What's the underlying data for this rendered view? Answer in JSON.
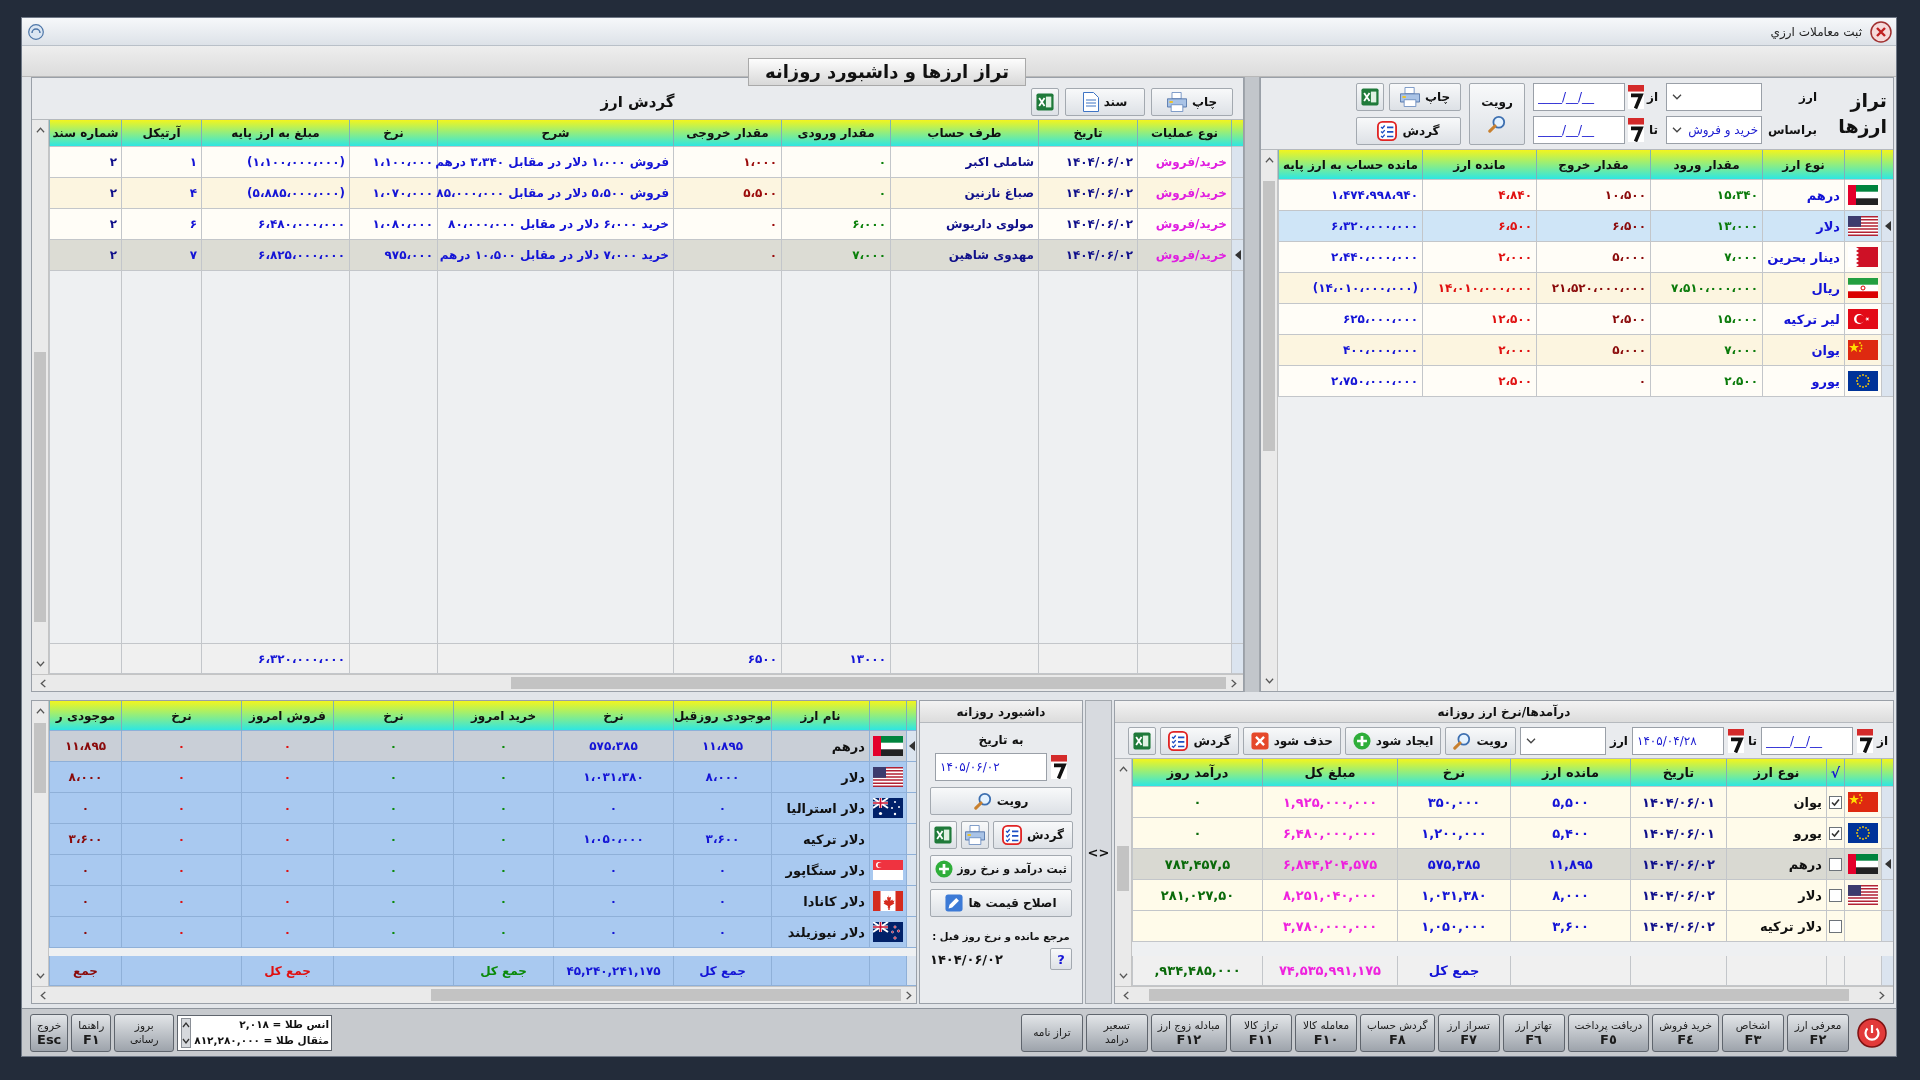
{
  "window": {
    "title": "ثبت معاملات ارزي"
  },
  "page_title": "تراز ارزها و داشبورد روزانه",
  "balance_panel": {
    "title": "تراز ارزها",
    "currency_label": "ارز",
    "basis_label": "براساس",
    "basis_value": "خرید و فروش",
    "from_label": "از",
    "from_date": {
      "placeholder": "____/__/__"
    },
    "to_label": "تا",
    "to_date": {
      "placeholder": "____/__/__"
    },
    "view_button": "رویت",
    "print_button": "چاپ",
    "turnover_button": "گردش",
    "columns": {
      "name": "نوع ارز",
      "incoming": "مقدار ورود",
      "outgoing": "مقدار خروج",
      "balance": "مانده ارز",
      "base_balance": "مانده حساب به ارز پایه"
    },
    "rows": [
      {
        "kind": "uae",
        "selected": false,
        "name": "درهم",
        "incoming": "۱۵،۳۴۰",
        "outgoing": "۱۰،۵۰۰",
        "balance": "۴،۸۴۰",
        "base_balance": "۱،۴۷۴،۹۹۸،۹۴۰"
      },
      {
        "kind": "usa",
        "selected": true,
        "name": "دلار",
        "incoming": "۱۳،۰۰۰",
        "outgoing": "۶،۵۰۰",
        "balance": "۶،۵۰۰",
        "base_balance": "۶،۳۲۰،۰۰۰،۰۰۰"
      },
      {
        "kind": "bahrain",
        "selected": false,
        "name": "دینار بحرین",
        "incoming": "۷،۰۰۰",
        "outgoing": "۵،۰۰۰",
        "balance": "۲،۰۰۰",
        "base_balance": "۲،۴۴۰،۰۰۰،۰۰۰"
      },
      {
        "kind": "iran",
        "selected": false,
        "name": "ریال",
        "incoming": "۷،۵۱۰،۰۰۰،۰۰۰",
        "outgoing": "۲۱،۵۲۰،۰۰۰،۰۰۰",
        "balance": "۱۴،۰۱۰،۰۰۰،۰۰۰",
        "base_balance": "(۱۴،۰۱۰،۰۰۰،۰۰۰)"
      },
      {
        "kind": "turkey",
        "selected": false,
        "name": "لیر ترکیه",
        "incoming": "۱۵،۰۰۰",
        "outgoing": "۲،۵۰۰",
        "balance": "۱۲،۵۰۰",
        "base_balance": "۶۲۵،۰۰۰،۰۰۰"
      },
      {
        "kind": "china",
        "selected": false,
        "name": "یوان",
        "incoming": "۷،۰۰۰",
        "outgoing": "۵،۰۰۰",
        "balance": "۲،۰۰۰",
        "base_balance": "۴۰۰،۰۰۰،۰۰۰"
      },
      {
        "kind": "eu",
        "selected": false,
        "name": "یورو",
        "incoming": "۲،۵۰۰",
        "outgoing": "۰",
        "balance": "۲،۵۰۰",
        "base_balance": "۲،۷۵۰،۰۰۰،۰۰۰"
      }
    ]
  },
  "turnover_panel": {
    "title": "گردش ارز",
    "print_button": "چاپ",
    "document_button": "سند",
    "columns": {
      "operation": "نوع عملیات",
      "date": "تاریخ",
      "counterparty": "طرف حساب",
      "incoming": "مقدار ورودی",
      "outgoing": "مقدار خروجی",
      "description": "شرح",
      "rate": "نرخ",
      "base_amount": "مبلغ به ارز پایه",
      "article": "آرتیکل",
      "doc_number": "شماره سند"
    },
    "rows": [
      {
        "selected": false,
        "operation": "خرید/فروش",
        "date": "۱۴۰۴/۰۶/۰۲",
        "counterparty": "شاملی اکبر",
        "incoming": "۰",
        "outgoing": "۱،۰۰۰",
        "description": "فروش ۱،۰۰۰ دلار در مقابل ۳،۳۴۰ درهم",
        "rate": "۱،۱۰۰،۰۰۰",
        "base_amount": "(۱،۱۰۰،۰۰۰،۰۰۰)",
        "article": "۱",
        "doc_number": "۲"
      },
      {
        "selected": false,
        "operation": "خرید/فروش",
        "date": "۱۴۰۴/۰۶/۰۲",
        "counterparty": "صباغ نازنین",
        "incoming": "۰",
        "outgoing": "۵،۵۰۰",
        "description": "فروش ۵،۵۰۰ دلار در مقابل ۸۵،۰۰۰،۰۰۰",
        "rate": "۱،۰۷۰،۰۰۰",
        "base_amount": "(۵،۸۸۵،۰۰۰،۰۰۰)",
        "article": "۴",
        "doc_number": "۲"
      },
      {
        "selected": false,
        "operation": "خرید/فروش",
        "date": "۱۴۰۴/۰۶/۰۲",
        "counterparty": "مولوی داریوش",
        "incoming": "۶،۰۰۰",
        "outgoing": "۰",
        "description": "خرید ۶،۰۰۰ دلار در مقابل ۸۰،۰۰۰،۰۰۰",
        "rate": "۱،۰۸۰،۰۰۰",
        "base_amount": "۶،۴۸۰،۰۰۰،۰۰۰",
        "article": "۶",
        "doc_number": "۲"
      },
      {
        "selected": true,
        "operation": "خرید/فروش",
        "date": "۱۴۰۴/۰۶/۰۲",
        "counterparty": "مهدوی شاهین",
        "incoming": "۷،۰۰۰",
        "outgoing": "۰",
        "description": "خرید ۷،۰۰۰ دلار در مقابل ۱۰،۵۰۰ درهم",
        "rate": "۹۷۵،۰۰۰",
        "base_amount": "۶،۸۲۵،۰۰۰،۰۰۰",
        "article": "۷",
        "doc_number": "۲"
      }
    ],
    "totals": {
      "incoming": "۱۳۰۰۰",
      "outgoing": "۶۵۰۰",
      "base_amount": "۶،۳۲۰،۰۰۰،۰۰۰"
    }
  },
  "inventory_panel": {
    "columns": {
      "name": "نام ارز",
      "prev_balance": "موجودی روزقبل",
      "prev_rate": "نرخ",
      "buy_today": "خرید امروز",
      "buy_rate": "نرخ",
      "sell_today": "فروش امروز",
      "sell_rate": "نرخ",
      "balance": "موجودی ر"
    },
    "rows": [
      {
        "kind": "uae",
        "selected": true,
        "name": "درهم",
        "prev_balance": "۱۱،۸۹۵",
        "prev_rate": "۵۷۵،۳۸۵",
        "buy_today": "۰",
        "buy_rate": "۰",
        "sell_today": "۰",
        "sell_rate": "۰",
        "balance": "۱۱،۸۹۵"
      },
      {
        "kind": "usa",
        "selected": false,
        "name": "دلار",
        "prev_balance": "۸،۰۰۰",
        "prev_rate": "۱،۰۳۱،۳۸۰",
        "buy_today": "۰",
        "buy_rate": "۰",
        "sell_today": "۰",
        "sell_rate": "۰",
        "balance": "۸،۰۰۰"
      },
      {
        "kind": "australia",
        "selected": false,
        "name": "دلار استرالیا",
        "prev_balance": "۰",
        "prev_rate": "۰",
        "buy_today": "۰",
        "buy_rate": "۰",
        "sell_today": "۰",
        "sell_rate": "۰",
        "balance": "۰"
      },
      {
        "selected": false,
        "name": "دلار ترکیه",
        "prev_balance": "۳،۶۰۰",
        "prev_rate": "۱،۰۵۰،۰۰۰",
        "buy_today": "۰",
        "buy_rate": "۰",
        "sell_today": "۰",
        "sell_rate": "۰",
        "balance": "۳،۶۰۰"
      },
      {
        "kind": "singapore",
        "selected": false,
        "name": "دلار سنگاپور",
        "prev_balance": "۰",
        "prev_rate": "۰",
        "buy_today": "۰",
        "buy_rate": "۰",
        "sell_today": "۰",
        "sell_rate": "۰",
        "balance": "۰"
      },
      {
        "kind": "canada",
        "selected": false,
        "name": "دلار کانادا",
        "prev_balance": "۰",
        "prev_rate": "۰",
        "buy_today": "۰",
        "buy_rate": "۰",
        "sell_today": "۰",
        "sell_rate": "۰",
        "balance": "۰"
      },
      {
        "kind": "new_zealand",
        "selected": false,
        "name": "دلار نیوزیلند",
        "prev_balance": "۰",
        "prev_rate": "۰",
        "buy_today": "۰",
        "buy_rate": "۰",
        "sell_today": "۰",
        "sell_rate": "۰",
        "balance": "۰"
      }
    ],
    "totals": {
      "prev_balance": "جمع کل",
      "prev_rate": "۴۵,۲۴۰,۲۴۱,۱۷۵",
      "buy_today": "جمع کل",
      "sell_today": "جمع کل",
      "balance": "جمع"
    }
  },
  "dashboard": {
    "title": "داشبورد روزانه",
    "date_label": "به تاریخ",
    "date": {
      "value": "۱۴۰۵/۰۶/۰۲"
    },
    "view_button": "رویت",
    "turnover_button": "گردش",
    "register_button": "ثبت درآمد و نرخ روز",
    "fix_prices_button": "اصلاح قیمت ها",
    "reference_label": "مرجع مانده و نرخ روز قبل :",
    "help_button": "?",
    "reference_date": "۱۴۰۴/۰۶/۰۲"
  },
  "splitter": "<>",
  "income_panel": {
    "title": "درآمدها/نرخ ارز روزانه",
    "from_label": "از",
    "from_date": {
      "placeholder": "____/__/__"
    },
    "to_label": "تا",
    "to_date": {
      "value": "۱۴۰۵/۰۴/۲۸"
    },
    "currency_label": "ارز",
    "view_button": "رویت",
    "create_button": "ایجاد شود",
    "delete_button": "حذف شود",
    "turnover_button": "گردش",
    "columns": {
      "check": "√",
      "name": "نوع ارز",
      "date": "تاریخ",
      "balance": "مانده ارز",
      "rate": "نرخ",
      "total": "مبلغ کل",
      "income": "درآمد روز"
    },
    "rows": [
      {
        "kind": "china",
        "checked": true,
        "selected": false,
        "name": "یوان",
        "date": "۱۴۰۴/۰۶/۰۱",
        "balance": "۵,۵۰۰",
        "rate": "۳۵۰,۰۰۰",
        "total": "۱,۹۲۵,۰۰۰,۰۰۰",
        "income": "۰"
      },
      {
        "kind": "eu",
        "checked": true,
        "selected": false,
        "name": "یورو",
        "date": "۱۴۰۴/۰۶/۰۱",
        "balance": "۵,۴۰۰",
        "rate": "۱,۲۰۰,۰۰۰",
        "total": "۶,۴۸۰,۰۰۰,۰۰۰",
        "income": "۰"
      },
      {
        "kind": "uae",
        "checked": false,
        "selected": true,
        "name": "درهم",
        "date": "۱۴۰۴/۰۶/۰۲",
        "balance": "۱۱,۸۹۵",
        "rate": "۵۷۵,۳۸۵",
        "total": "۶,۸۴۴,۲۰۴,۵۷۵",
        "income": "۷۸۳,۴۵۷,۵"
      },
      {
        "kind": "usa",
        "checked": false,
        "selected": false,
        "name": "دلار",
        "date": "۱۴۰۴/۰۶/۰۲",
        "balance": "۸,۰۰۰",
        "rate": "۱,۰۳۱,۳۸۰",
        "total": "۸,۲۵۱,۰۴۰,۰۰۰",
        "income": "۲۸۱,۰۲۷,۵۰"
      },
      {
        "checked": false,
        "selected": false,
        "name": "دلار ترکیه",
        "date": "۱۴۰۴/۰۶/۰۲",
        "balance": "۳,۶۰۰",
        "rate": "۱,۰۵۰,۰۰۰",
        "total": "۳,۷۸۰,۰۰۰,۰۰۰"
      }
    ],
    "totals": {
      "rate": "جمع کل",
      "total": "۷۴,۵۳۵,۹۹۱,۱۷۵",
      "income": ",۹۳۴,۴۸۵,۰۰۰"
    }
  },
  "toolbar": {
    "buttons": [
      {
        "kind": "power"
      },
      {
        "kind": "function",
        "label": "معرفی ارز",
        "key": "F٢"
      },
      {
        "kind": "function",
        "label": "اشخاص",
        "key": "F٣"
      },
      {
        "kind": "function",
        "label": "خرید فروش",
        "key": "F٤"
      },
      {
        "kind": "function",
        "label": "دریافت پرداخت",
        "key": "F٥"
      },
      {
        "kind": "function",
        "label": "تهاتر ارز",
        "key": "F٦"
      },
      {
        "kind": "function",
        "label": "تسراز ارز",
        "key": "F٧"
      },
      {
        "kind": "function",
        "label": "گردش حساب",
        "key": "F٨"
      },
      {
        "kind": "function",
        "label": "معامله کالا",
        "key": "F١٠"
      },
      {
        "kind": "function",
        "label": "تراز کالا",
        "key": "F١١"
      },
      {
        "kind": "function",
        "label": "مبادله زوج ارز",
        "key": "F١٢"
      },
      {
        "kind": "function",
        "label": "تسعیر درامد"
      },
      {
        "kind": "function",
        "label": "تراز نامه"
      }
    ],
    "ticker": [
      "انس طلا = ۲,۰۱۸",
      "مثقال طلا = ۸۱۲,۲۸۰,۰۰۰"
    ],
    "left_buttons": [
      {
        "kind": "function",
        "label": "بروز رسانی"
      },
      {
        "kind": "function",
        "label": "راهنما",
        "key": "F١"
      },
      {
        "kind": "function",
        "label": "خروج",
        "key": "Esc"
      }
    ]
  }
}
